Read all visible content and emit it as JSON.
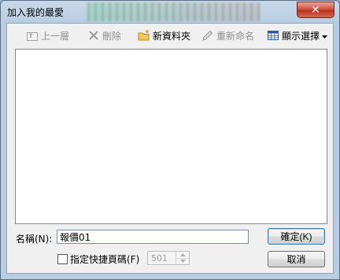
{
  "window": {
    "title": "加入我的最愛",
    "close_glyph": "✕"
  },
  "toolbar": {
    "up_label": "上一層",
    "delete_label": "刪除",
    "new_folder_label": "新資料夾",
    "rename_label": "重新命名",
    "view_label": "顯示選擇"
  },
  "form": {
    "name_label": "名稱(N):",
    "name_value": "報價01",
    "shortcut_label": "指定快捷頁碼(F)",
    "shortcut_value": "501",
    "shortcut_checked": false
  },
  "buttons": {
    "ok_label": "確定(K)",
    "cancel_label": "取消"
  },
  "colors": {
    "close_button": "#c8402a",
    "disabled_text": "#8f8f8f"
  }
}
